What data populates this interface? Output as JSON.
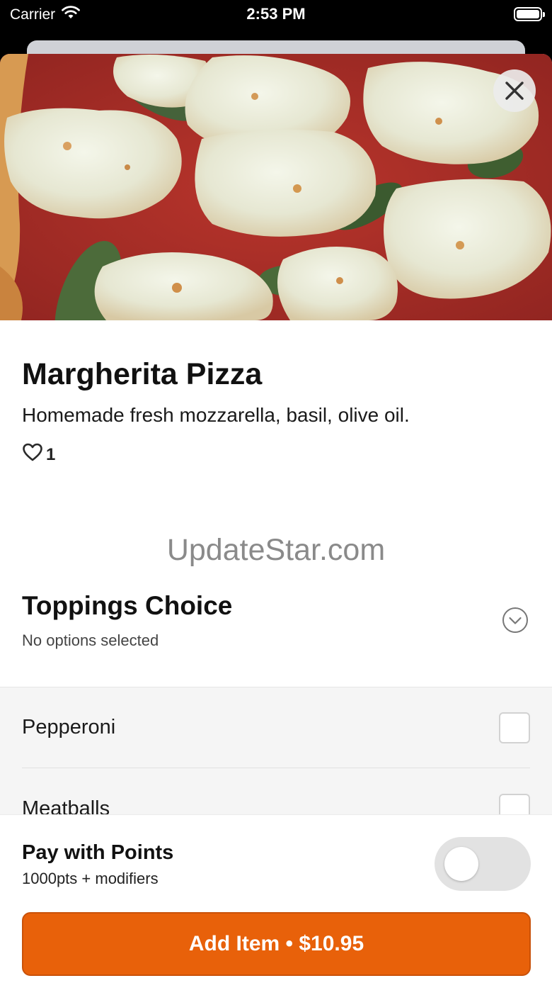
{
  "status_bar": {
    "carrier": "Carrier",
    "time": "2:53 PM",
    "icons": [
      "wifi-icon",
      "battery-icon"
    ]
  },
  "hero": {
    "image": "margherita-pizza-photo",
    "close_icon": "close-icon"
  },
  "item": {
    "title": "Margherita Pizza",
    "description": "Homemade fresh mozzarella, basil, olive oil.",
    "likes_icon": "heart-outline-icon",
    "likes_count": "1"
  },
  "watermark": "UpdateStar.com",
  "toppings": {
    "title": "Toppings Choice",
    "subtitle": "No options selected",
    "chevron_icon": "chevron-down-circle-icon",
    "options": [
      {
        "label": "Pepperoni",
        "checked": false
      },
      {
        "label": "Meatballs",
        "checked": false
      }
    ]
  },
  "points": {
    "title": "Pay with Points",
    "subtitle": "1000pts + modifiers",
    "enabled": false
  },
  "add_button": {
    "label": "Add Item • $10.95"
  },
  "colors": {
    "accent": "#e8610a",
    "sheet_background": "#ffffff",
    "options_background": "#f5f5f5"
  }
}
